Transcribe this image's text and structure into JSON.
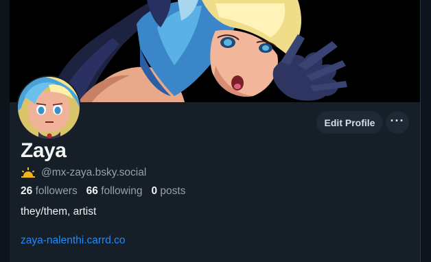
{
  "profile": {
    "display_name": "Zaya",
    "handle": "@mx-zaya.bsky.social",
    "followers_count": "26",
    "followers_label": "followers",
    "following_count": "66",
    "following_label": "following",
    "posts_count": "0",
    "posts_label": "posts",
    "bio": "they/them, artist",
    "link": "zaya-nalenthi.carrd.co"
  },
  "actions": {
    "edit_label": "Edit Profile",
    "more_label": "···"
  },
  "icons": {
    "badge": "sun-icon",
    "more": "ellipsis-icon"
  },
  "colors": {
    "background": "#161e27",
    "button": "#1e2936",
    "link": "#208bfe",
    "muted_text": "#95a2b0",
    "text": "#f1f3f5"
  }
}
